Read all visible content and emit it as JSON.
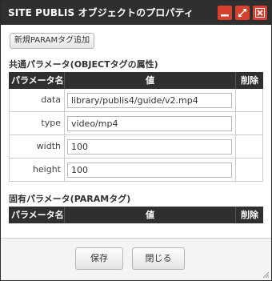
{
  "window": {
    "title": "SITE PUBLIS オブジェクトのプロパティ",
    "accent_color": "#d6412f",
    "titlebar_color": "#2f2f2f"
  },
  "toolbar": {
    "add_param_label": "新規PARAMタグ追加"
  },
  "common_params": {
    "section_title": "共通パラメータ(OBJECTタグの属性)",
    "headers": [
      "パラメータ名",
      "値",
      "削除"
    ],
    "rows": [
      {
        "name": "data",
        "value": "library/publis4/guide/v2.mp4"
      },
      {
        "name": "type",
        "value": "video/mp4"
      },
      {
        "name": "width",
        "value": "100"
      },
      {
        "name": "height",
        "value": "100"
      }
    ]
  },
  "custom_params": {
    "section_title": "固有パラメータ(PARAMタグ)",
    "headers": [
      "パラメータ名",
      "値",
      "削除"
    ]
  },
  "footer": {
    "save_label": "保存",
    "close_label": "閉じる"
  }
}
